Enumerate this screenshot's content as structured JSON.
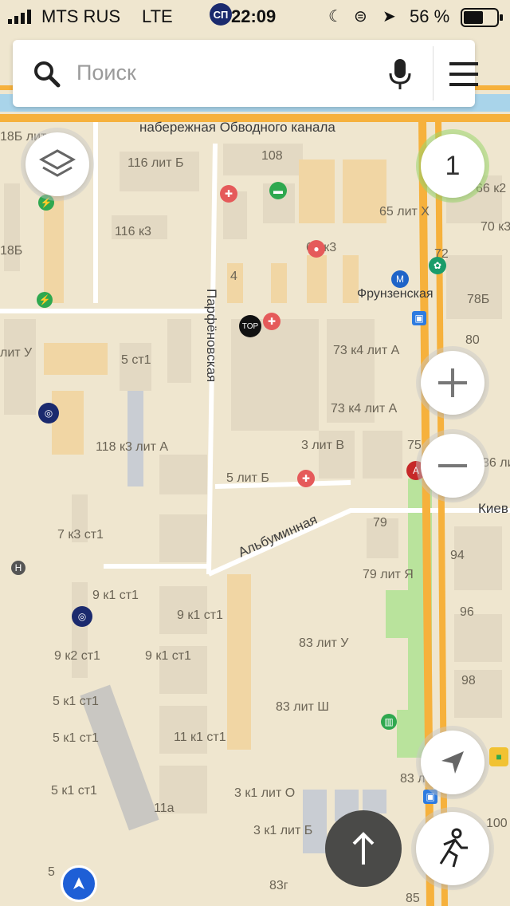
{
  "status_bar": {
    "carrier": "MTS RUS",
    "network": "LTE",
    "badge": "СП",
    "time": "22:09",
    "battery": "56 %"
  },
  "search": {
    "placeholder": "Поиск"
  },
  "traffic_level": "1",
  "streets": {
    "embankment": "набережная Обводного канала",
    "parfenovskaya": "Парфёновская",
    "albuminnaya": "Альбуминная",
    "kiev": "Киев",
    "metro": "Фрунзенская"
  },
  "house_numbers": {
    "h1": "18Б лит",
    "h2": "116 лит Б",
    "h3": "108",
    "h4": "66 к2",
    "h5": "65 лит Х",
    "h6": "116 к3",
    "h7": "70 к3",
    "h8": "18Б",
    "h9": "65 к3",
    "h10": "72",
    "h11": "4",
    "h12": "78Б",
    "h13": "лит У",
    "h14": "80",
    "h15": "5 ст1",
    "h16": "73 к4 лит А",
    "h17": "73 к4 лит А",
    "h18": "118 к3 лит А",
    "h19": "3 лит В",
    "h20": "75",
    "h21": "36 ли",
    "h22": "5 лит Б",
    "h23": "7 к3 ст1",
    "h24": "79",
    "h25": "94",
    "h26": "79 лит Я",
    "h27": "9 к1 ст1",
    "h28": "9 к1 ст1",
    "h29": "96",
    "h30": "83 лит У",
    "h31": "9 к2 ст1",
    "h32": "9 к1 ст1",
    "h33": "98",
    "h34": "5 к1 ст1",
    "h35": "83 лит Ш",
    "h36": "5 к1 ст1",
    "h37": "11 к1 ст1",
    "h38": "83 л",
    "h39": "5 к1 ст1",
    "h40": "3 к1 лит О",
    "h41": "11а",
    "h42": "100",
    "h43": "3 к1 лит Б",
    "h44": "5",
    "h45": "83г",
    "h46": "85"
  },
  "poi_labels": {
    "top": "TOP"
  },
  "colors": {
    "map_bg": "#efe6cf",
    "building": "#e3d9c3",
    "highlight_building": "#f1d6a4",
    "road_main": "#f6b13c",
    "road_minor": "#ffffff",
    "canal": "#a9d4ea",
    "park": "#b9e39c",
    "accent_dark": "#4a4a48"
  }
}
